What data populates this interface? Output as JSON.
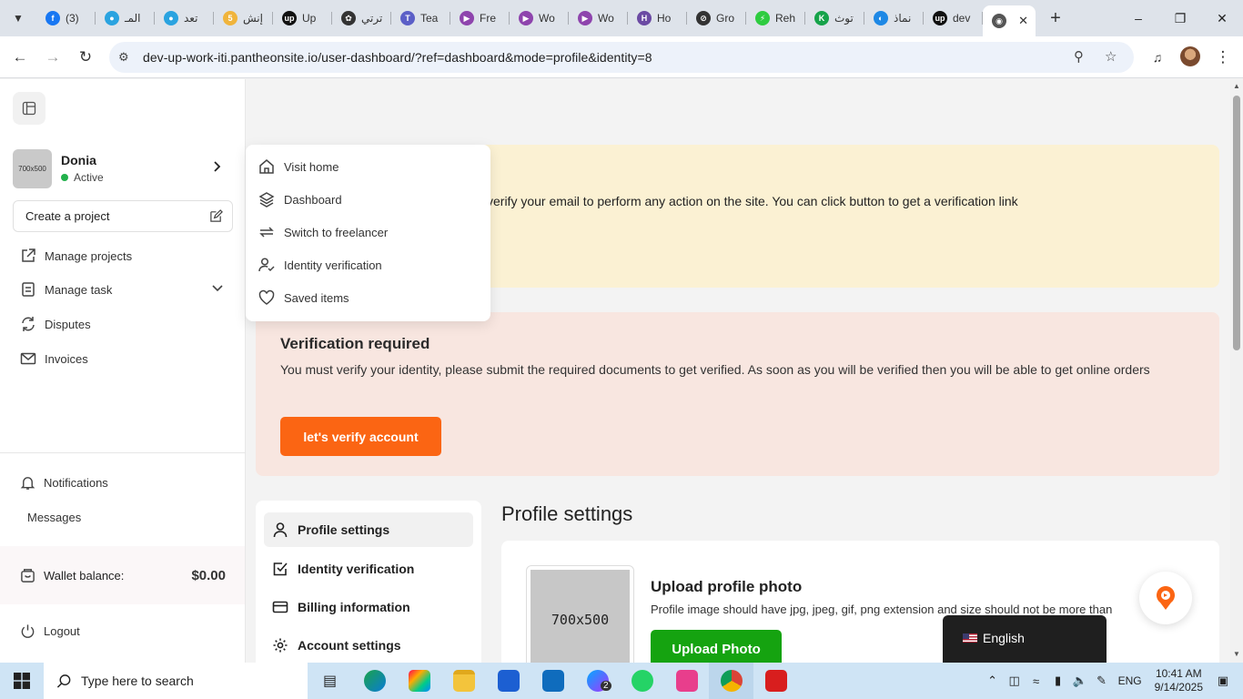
{
  "browser": {
    "tabs": [
      {
        "label": "(3)",
        "color": "#1877f2",
        "glyph": "f"
      },
      {
        "label": "المـ",
        "color": "#2aa3e0",
        "glyph": "●"
      },
      {
        "label": "تعد",
        "color": "#2aa3e0",
        "glyph": "●"
      },
      {
        "label": "إنش",
        "color": "#f0b43c",
        "glyph": "5"
      },
      {
        "label": "Up",
        "color": "#111111",
        "glyph": "up"
      },
      {
        "label": "ترتي",
        "color": "#333333",
        "glyph": "✿"
      },
      {
        "label": "Tea",
        "color": "#5b5fc7",
        "glyph": "T"
      },
      {
        "label": "Fre",
        "color": "#8e44ad",
        "glyph": "▶"
      },
      {
        "label": "Wo",
        "color": "#8e44ad",
        "glyph": "▶"
      },
      {
        "label": "Wo",
        "color": "#8e44ad",
        "glyph": "▶"
      },
      {
        "label": "Ho",
        "color": "#6b4aa3",
        "glyph": "H"
      },
      {
        "label": "Gro",
        "color": "#333333",
        "glyph": "⊘"
      },
      {
        "label": "Reh",
        "color": "#2ecc40",
        "glyph": "⚡"
      },
      {
        "label": "توث",
        "color": "#16a34a",
        "glyph": "K"
      },
      {
        "label": "نماذ",
        "color": "#1e88e5",
        "glyph": "◐"
      },
      {
        "label": "dev",
        "color": "#111111",
        "glyph": "up"
      }
    ],
    "active_tab_icon": "globe-icon",
    "url": "dev-up-work-iti.pantheonsite.io/user-dashboard/?ref=dashboard&mode=profile&identity=8"
  },
  "sidebar": {
    "user_name": "Donia",
    "user_status": "Active",
    "avatar_text": "700x500",
    "create_project": "Create a project",
    "items": [
      {
        "label": "Manage projects",
        "icon": "external-link-icon"
      },
      {
        "label": "Manage task",
        "icon": "clipboard-icon"
      },
      {
        "label": "Disputes",
        "icon": "refresh-icon"
      },
      {
        "label": "Invoices",
        "icon": "mail-icon"
      }
    ],
    "notifications": "Notifications",
    "messages": "Messages",
    "wallet_label": "Wallet balance:",
    "wallet_amount": "$0.00",
    "logout": "Logout"
  },
  "dropdown": {
    "items": [
      {
        "label": "Visit home",
        "icon": "home-icon"
      },
      {
        "label": "Dashboard",
        "icon": "layers-icon"
      },
      {
        "label": "Switch to freelancer",
        "icon": "switch-icon"
      },
      {
        "label": "Identity verification",
        "icon": "user-check-icon"
      },
      {
        "label": "Saved items",
        "icon": "heart-icon"
      }
    ]
  },
  "email_banner": {
    "text": "verify your email to perform any action on the site. You can click button to get a verification link"
  },
  "verify_banner": {
    "title": "Verification required",
    "text": "You must verify your identity, please submit the required documents to get verified. As soon as you will be verified then you will be able to get online orders",
    "button": "let's verify account"
  },
  "settings_nav": {
    "items": [
      {
        "label": "Profile settings",
        "icon": "user-icon"
      },
      {
        "label": "Identity verification",
        "icon": "checkbox-icon"
      },
      {
        "label": "Billing information",
        "icon": "card-icon"
      },
      {
        "label": "Account settings",
        "icon": "gear-icon"
      }
    ]
  },
  "profile": {
    "title": "Profile settings",
    "photo_text": "700x500",
    "upload_title": "Upload profile photo",
    "upload_desc": "Profile image should have jpg, jpeg, gif, png extension and size should not be more than",
    "upload_button": "Upload Photo"
  },
  "language": "English",
  "taskbar": {
    "search_placeholder": "Type here to search",
    "lang": "ENG",
    "time": "10:41 AM",
    "date": "9/14/2025",
    "badge": "2"
  },
  "colors": {
    "accent_orange": "#fb6513",
    "upload_green": "#15a310",
    "email_banner_bg": "#fbf1d3",
    "verify_banner_bg": "#f8e6e0"
  }
}
